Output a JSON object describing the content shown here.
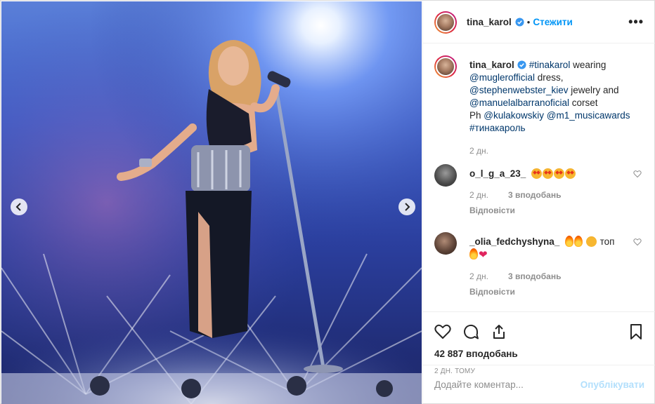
{
  "post": {
    "username": "tina_karol",
    "follow_label": "Стежити",
    "more_label": "•••",
    "caption": {
      "hashtag1": "#tinakarol",
      "text1": " wearing",
      "mention1": "@muglerofficial",
      "text2": " dress,",
      "mention2": "@stephenwebster_kiev",
      "text3": " jewelry and",
      "mention3": "@manuelalbarranoficial",
      "text4": " corset",
      "text5": "Ph ",
      "mention4": "@kulakowskiy",
      "mention5": "@m1_musicawards",
      "hashtag2": "#тинакароль",
      "age": "2 дн."
    },
    "comments": [
      {
        "user": "o_l_g_a_23_",
        "age": "2 дн.",
        "likes": "3 вподобань",
        "reply": "Відповісти"
      },
      {
        "user": "_olia_fedchyshyna_",
        "text_a": " топ",
        "age": "2 дн.",
        "likes": "3 вподобань",
        "reply": "Відповісти"
      }
    ],
    "likes_count": "42 887 вподобань",
    "date": "2 дн. тому",
    "add_comment_placeholder": "Додайте коментар...",
    "post_label": "Опублікувати"
  },
  "icons": {
    "like": "heart-icon",
    "comment": "comment-icon",
    "share": "share-icon",
    "save": "bookmark-icon"
  },
  "colors": {
    "link": "#00376b",
    "follow": "#0095f6",
    "post_disabled": "#b2dffc",
    "muted": "#8e8e8e"
  }
}
